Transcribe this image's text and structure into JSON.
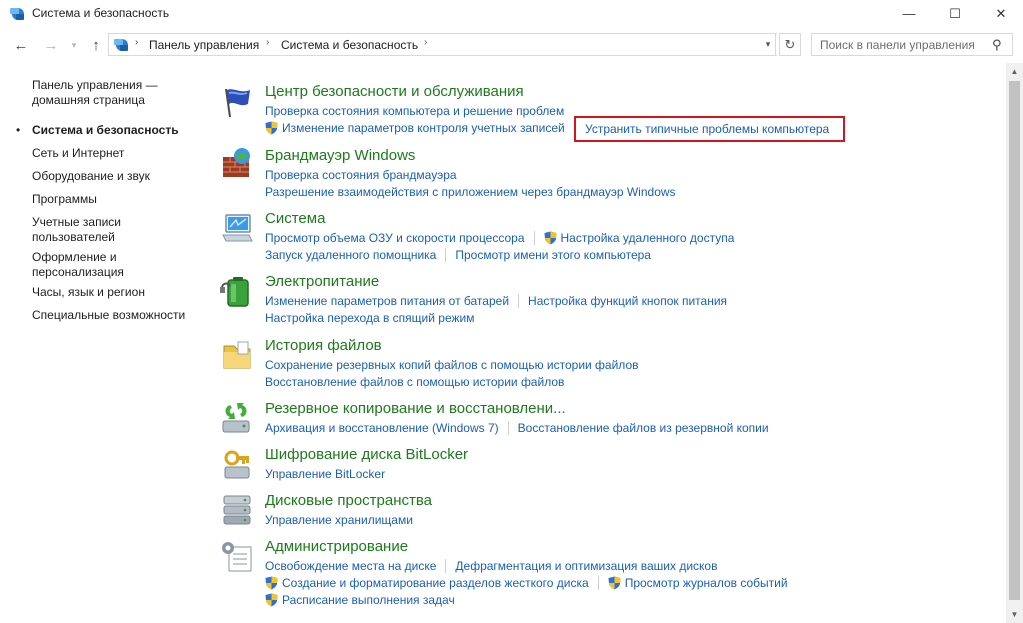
{
  "window": {
    "title": "Система и безопасность",
    "minimize_glyph": "—",
    "maximize_glyph": "☐",
    "close_glyph": "✕"
  },
  "nav": {
    "back_glyph": "←",
    "forward_glyph": "→",
    "history_glyph": "▾",
    "up_glyph": "↑",
    "breadcrumbs": [
      "Панель управления",
      "Система и безопасность"
    ],
    "separator_glyph": "›",
    "dropdown_glyph": "▾",
    "refresh_glyph": "↻",
    "search_placeholder": "Поиск в панели управления",
    "search_glyph": "⚲"
  },
  "sidebar": {
    "items": [
      {
        "label": "Панель управления —",
        "label2": "домашняя страница"
      },
      {
        "label": "Система и безопасность",
        "active": true
      },
      {
        "label": "Сеть и Интернет"
      },
      {
        "label": "Оборудование и звук"
      },
      {
        "label": "Программы"
      },
      {
        "label": "Учетные записи",
        "label2": "пользователей"
      },
      {
        "label": "Оформление и",
        "label2": "персонализация"
      },
      {
        "label": "Часы, язык и регион"
      },
      {
        "label": "Специальные возможности"
      }
    ],
    "bullet_glyph": "•"
  },
  "categories": [
    {
      "title": "Центр безопасности и обслуживания",
      "icon": "security-flag-icon",
      "rows": [
        [
          "Проверка состояния компьютера и решение проблем"
        ],
        [
          "Изменение параметров контроля учетных записей"
        ]
      ],
      "highlight_link": "Устранить типичные проблемы компьютера"
    },
    {
      "title": "Брандмауэр Windows",
      "icon": "firewall-icon",
      "rows": [
        [
          "Проверка состояния брандмауэра"
        ],
        [
          "Разрешение взаимодействия с приложением через брандмауэр Windows"
        ]
      ]
    },
    {
      "title": "Система",
      "icon": "system-monitor-icon",
      "rows": [
        [
          "Просмотр объема ОЗУ и скорости процессора",
          "Настройка удаленного доступа"
        ],
        [
          "Запуск удаленного помощника",
          "Просмотр имени этого компьютера"
        ]
      ]
    },
    {
      "title": "Электропитание",
      "icon": "power-battery-icon",
      "rows": [
        [
          "Изменение параметров питания от батарей",
          "Настройка функций кнопок питания"
        ],
        [
          "Настройка перехода в спящий режим"
        ]
      ]
    },
    {
      "title": "История файлов",
      "icon": "file-history-icon",
      "rows": [
        [
          "Сохранение резервных копий файлов с помощью истории файлов"
        ],
        [
          "Восстановление файлов с помощью истории файлов"
        ]
      ]
    },
    {
      "title": "Резервное копирование и восстановлени...",
      "icon": "backup-restore-icon",
      "rows": [
        [
          "Архивация и восстановление (Windows 7)",
          "Восстановление файлов из резервной копии"
        ]
      ]
    },
    {
      "title": "Шифрование диска BitLocker",
      "icon": "bitlocker-icon",
      "rows": [
        [
          "Управление BitLocker"
        ]
      ]
    },
    {
      "title": "Дисковые пространства",
      "icon": "storage-spaces-icon",
      "rows": [
        [
          "Управление хранилищами"
        ]
      ]
    },
    {
      "title": "Администрирование",
      "icon": "admin-tools-icon",
      "rows": [
        [
          "Освобождение места на диске",
          "Дефрагментация и оптимизация ваших дисков"
        ],
        [
          "Создание и форматирование разделов жесткого диска",
          "Просмотр журналов событий"
        ],
        [
          "Расписание выполнения задач"
        ]
      ]
    }
  ],
  "scrollbar": {
    "up_glyph": "▲",
    "down_glyph": "▼"
  },
  "colors": {
    "category_title": "#1d7a1d",
    "link": "#1a5fb4",
    "highlight_border": "#d3151c"
  }
}
